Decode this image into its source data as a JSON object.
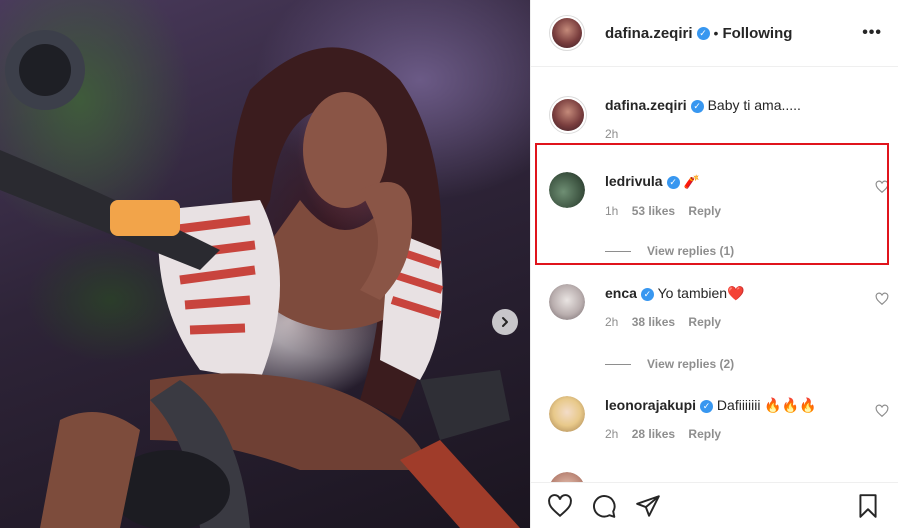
{
  "post": {
    "author": "dafina.zeqiri",
    "status": "Following",
    "separator": "•",
    "more": "•••"
  },
  "comments": [
    {
      "user": "dafina.zeqiri",
      "text": "Baby ti ama.....",
      "time": "2h",
      "likes": "",
      "reply": "",
      "verified": true
    },
    {
      "user": "ledrivula",
      "text": "🧨",
      "time": "1h",
      "likes": "53 likes",
      "reply": "Reply",
      "view_replies": "View replies (1)",
      "verified": true
    },
    {
      "user": "enca",
      "text": "Yo tambien❤️",
      "time": "2h",
      "likes": "38 likes",
      "reply": "Reply",
      "view_replies": "View replies (2)",
      "verified": true
    },
    {
      "user": "leonorajakupi",
      "text": "Dafiiiiiii 🔥🔥🔥",
      "time": "2h",
      "likes": "28 likes",
      "reply": "Reply",
      "verified": true
    }
  ],
  "colors": {
    "highlight": "#e0141c",
    "verified": "#3897f0",
    "muted": "#8e8e8e"
  },
  "icons": [
    "heart-icon",
    "comment-icon",
    "share-icon",
    "bookmark-icon",
    "chevron-right-icon",
    "more-icon"
  ]
}
